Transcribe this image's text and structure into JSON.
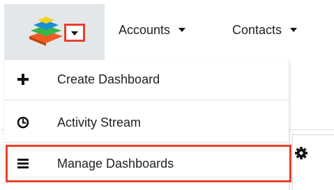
{
  "header": {
    "logo_icon": "sugar-cube-logo-icon",
    "menu_caret_icon": "caret-down-icon",
    "highlight_color": "#e8402a",
    "tabs": [
      {
        "label": "Accounts",
        "icon": "caret-down-icon"
      },
      {
        "label": "Contacts",
        "icon": "caret-down-icon"
      }
    ]
  },
  "dropdown": {
    "items": [
      {
        "label": "Create Dashboard",
        "icon": "plus-icon"
      },
      {
        "label": "Activity Stream",
        "icon": "clock-icon"
      },
      {
        "label": "Manage Dashboards",
        "icon": "bars-icon",
        "highlighted": true
      }
    ]
  },
  "background": {
    "settings_icon": "gear-icon"
  }
}
